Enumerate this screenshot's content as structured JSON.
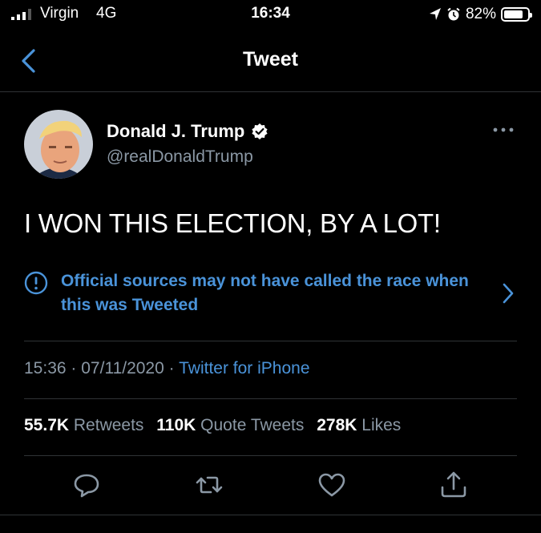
{
  "status_bar": {
    "carrier": "Virgin",
    "network": "4G",
    "time": "16:34",
    "battery": "82%",
    "battery_level": 0.82
  },
  "nav": {
    "title": "Tweet"
  },
  "tweet": {
    "author_name": "Donald J. Trump",
    "handle": "@realDonaldTrump",
    "text": "I WON THIS ELECTION, BY A LOT!",
    "notice": "Official sources may not have called the race when this was Tweeted",
    "time": "15:36",
    "date": "07/11/2020",
    "separator": "·",
    "source": "Twitter for iPhone"
  },
  "stats": {
    "retweets_count": "55.7K",
    "retweets_label": "Retweets",
    "quotes_count": "110K",
    "quotes_label": "Quote Tweets",
    "likes_count": "278K",
    "likes_label": "Likes"
  },
  "icons": {
    "back": "chevron-left-icon",
    "verified": "verified-badge-icon",
    "more": "ellipsis-icon",
    "notice": "info-icon",
    "reply": "reply-icon",
    "retweet": "retweet-icon",
    "like": "heart-icon",
    "share": "share-icon"
  },
  "colors": {
    "background": "#000000",
    "accent": "#4a93d9",
    "secondary_text": "#8b98a5",
    "divider": "#2f3336"
  }
}
